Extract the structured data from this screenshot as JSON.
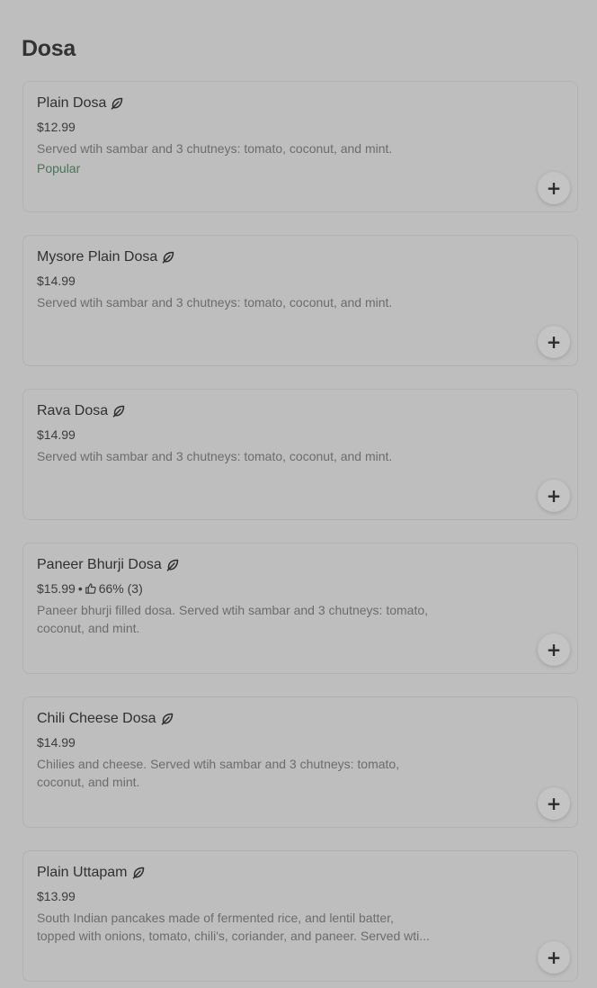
{
  "section": {
    "title": "Dosa"
  },
  "items": [
    {
      "name": "Plain Dosa",
      "price": "$12.99",
      "rating": "",
      "description": "Served wtih sambar and 3 chutneys: tomato, coconut, and mint.",
      "tag": "Popular",
      "icon": "leaf-icon",
      "add_label": "+"
    },
    {
      "name": "Mysore Plain Dosa",
      "price": "$14.99",
      "rating": "",
      "description": "Served wtih sambar and 3 chutneys: tomato, coconut, and mint.",
      "tag": "",
      "icon": "leaf-icon",
      "add_label": "+"
    },
    {
      "name": "Rava Dosa",
      "price": "$14.99",
      "rating": "",
      "description": "Served wtih sambar and 3 chutneys: tomato, coconut, and mint.",
      "tag": "",
      "icon": "leaf-icon",
      "add_label": "+"
    },
    {
      "name": "Paneer Bhurji Dosa",
      "price": "$15.99",
      "rating": "66% (3)",
      "description": "Paneer bhurji filled dosa. Served wtih sambar and 3 chutneys: tomato, coconut, and mint.",
      "tag": "",
      "icon": "leaf-icon",
      "add_label": "+"
    },
    {
      "name": "Chili Cheese Dosa",
      "price": "$14.99",
      "rating": "",
      "description": "Chilies and cheese. Served wtih sambar and 3 chutneys: tomato, coconut, and mint.",
      "tag": "",
      "icon": "leaf-icon",
      "add_label": "+"
    },
    {
      "name": "Plain Uttapam",
      "price": "$13.99",
      "rating": "",
      "description": "South Indian pancakes made of fermented rice, and lentil batter, topped with onions, tomato, chili's, coriander, and paneer. Served wti...",
      "tag": "",
      "icon": "leaf-icon",
      "add_label": "+"
    }
  ],
  "colors": {
    "background": "#bebebe",
    "card_border": "#b2b2b2",
    "text_primary": "#303030",
    "text_secondary": "#6c6c6c",
    "tag": "#4a7359"
  }
}
